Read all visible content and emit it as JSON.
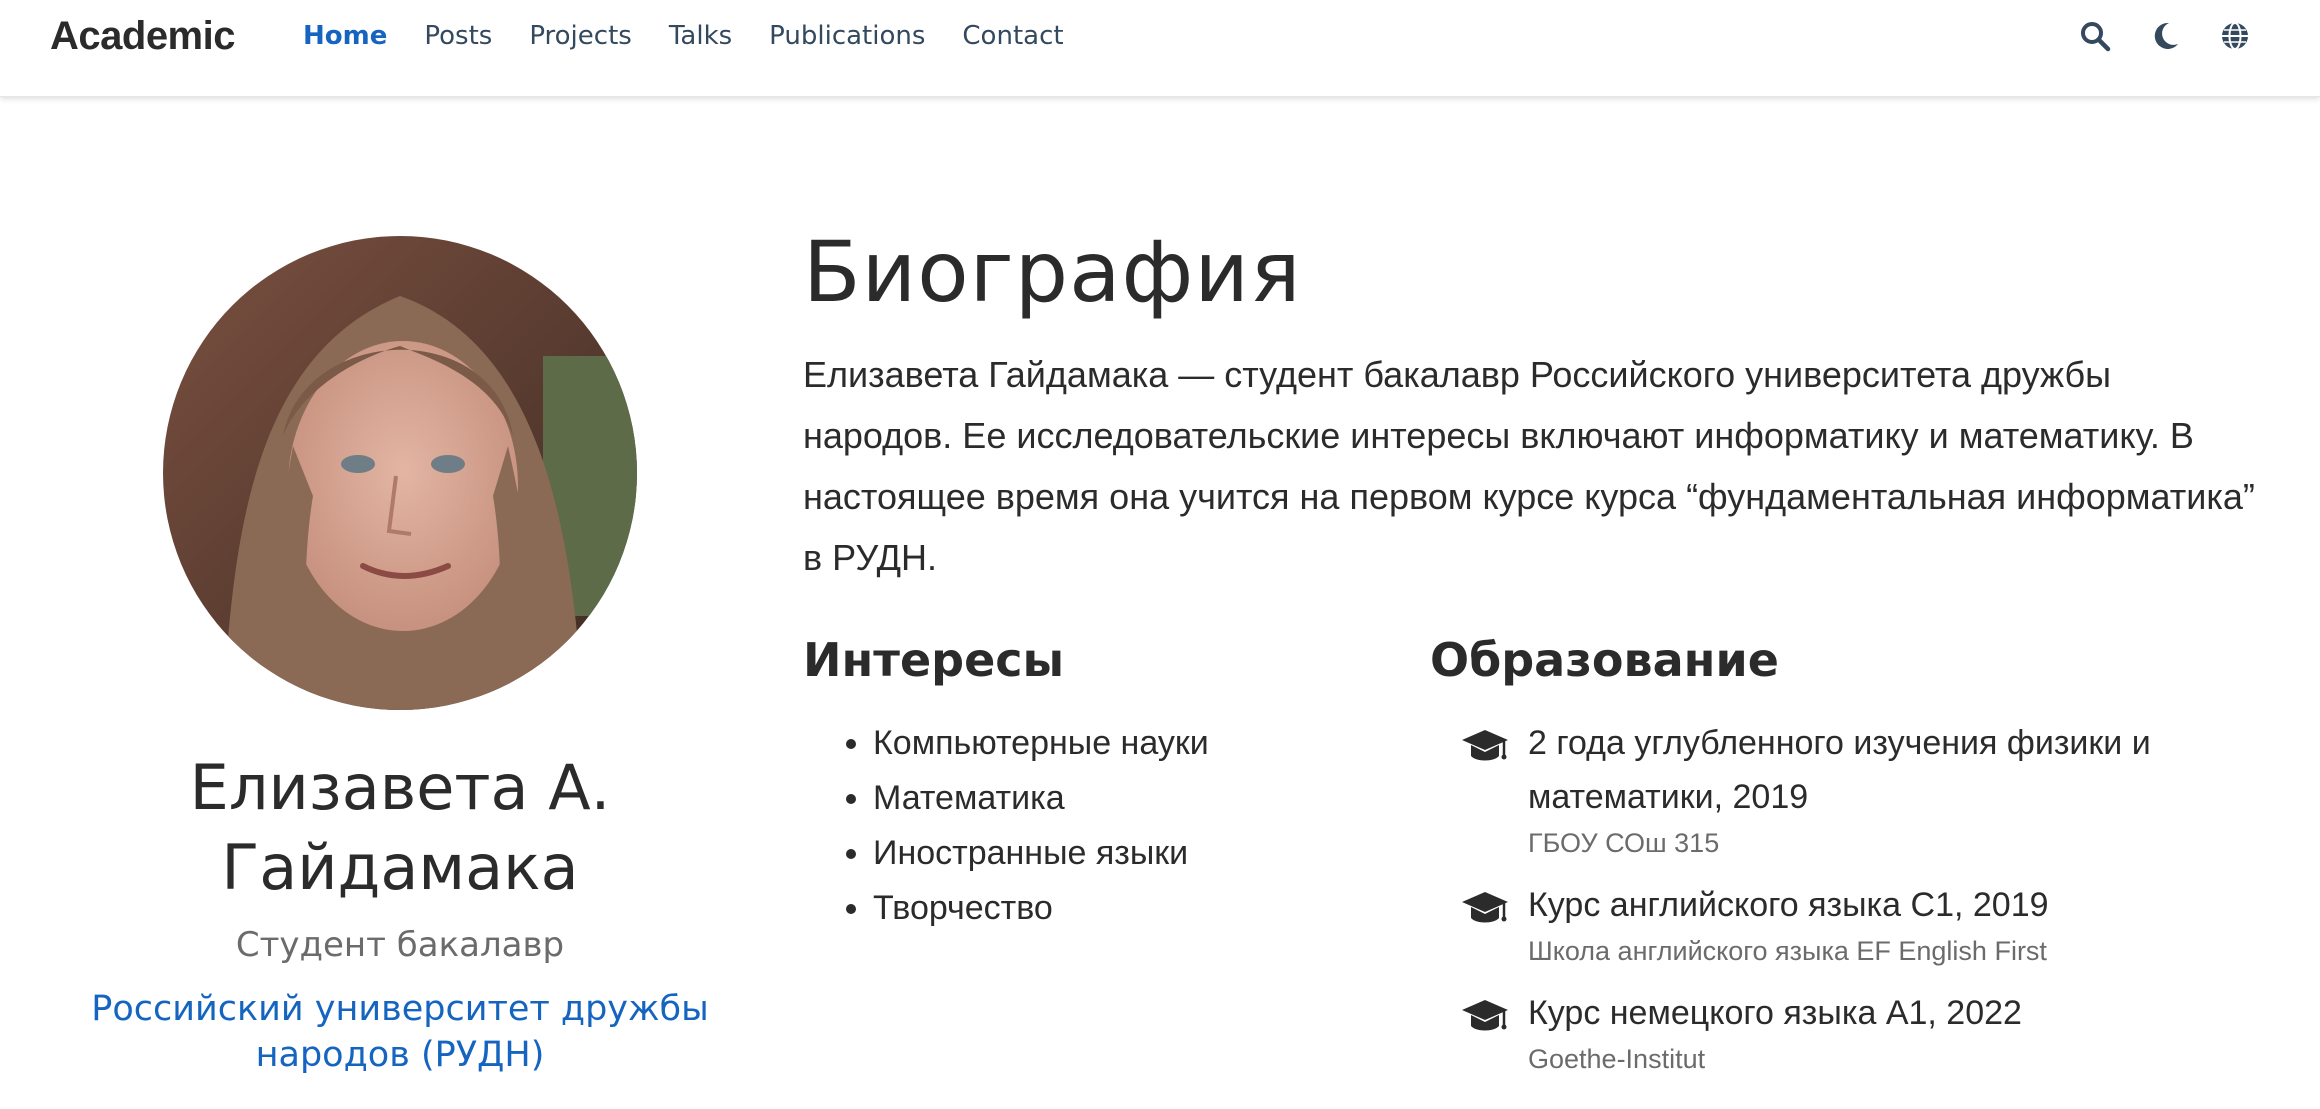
{
  "navbar": {
    "brand": "Academic",
    "links": [
      {
        "label": "Home",
        "active": true
      },
      {
        "label": "Posts",
        "active": false
      },
      {
        "label": "Projects",
        "active": false
      },
      {
        "label": "Talks",
        "active": false
      },
      {
        "label": "Publications",
        "active": false
      },
      {
        "label": "Contact",
        "active": false
      }
    ],
    "icons": [
      "search-icon",
      "moon-icon",
      "globe-icon"
    ]
  },
  "profile": {
    "name_line1": "Елизавета А.",
    "name_line2": "Гайдамака",
    "role": "Студент бакалавр",
    "org_line1": "Российский университет дружбы",
    "org_line2": "народов (РУДН)"
  },
  "biography": {
    "title": "Биография",
    "text": "Елизавета Гайдамака — студент бакалавр Российского университета дружбы народов. Ее исследовательские интересы включают информатику и математику. В настоящее время она учится на первом курсе курса “фундаментальная информатика” в РУДН."
  },
  "interests": {
    "title": "Интересы",
    "items": [
      "Компьютерные науки",
      "Математика",
      "Иностранные языки",
      "Творчество"
    ]
  },
  "education": {
    "title": "Образование",
    "items": [
      {
        "course": "2 года углубленного изучения физики и математики, 2019",
        "institution": "ГБОУ СОш 315"
      },
      {
        "course": "Курс английского языка С1, 2019",
        "institution": "Школа английского языка EF English First"
      },
      {
        "course": "Курс немецкого языка А1, 2022",
        "institution": "Goethe-Institut"
      }
    ]
  },
  "colors": {
    "accent": "#1565c0",
    "text": "#2b2b2b",
    "muted": "#6b6b6b",
    "nav_text": "#34495e"
  }
}
